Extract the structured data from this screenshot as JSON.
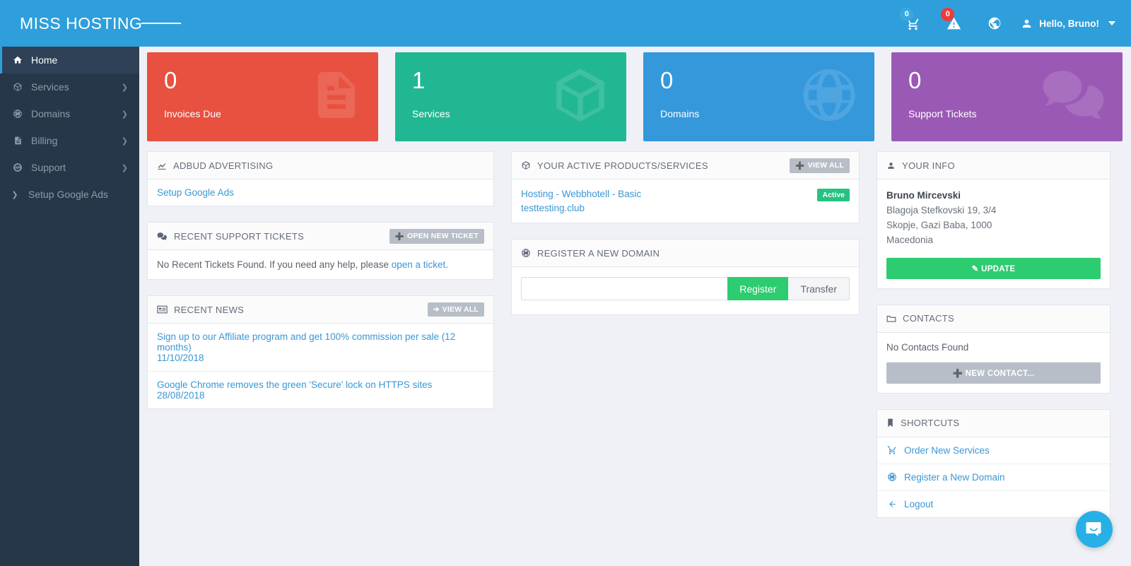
{
  "header": {
    "brand": "MISS HOSTING",
    "menu_toggle_icon": "hamburger-icon",
    "cart_badge": "0",
    "alert_badge": "0",
    "user_greeting": "Hello, Bruno!"
  },
  "sidebar": {
    "items": [
      {
        "label": "Home",
        "icon": "home-icon",
        "active": true,
        "chevron": false
      },
      {
        "label": "Services",
        "icon": "box-icon",
        "active": false,
        "chevron": true
      },
      {
        "label": "Domains",
        "icon": "globe-icon",
        "active": false,
        "chevron": true
      },
      {
        "label": "Billing",
        "icon": "file-icon",
        "active": false,
        "chevron": true
      },
      {
        "label": "Support",
        "icon": "lifering-icon",
        "active": false,
        "chevron": true
      },
      {
        "label": "Setup Google Ads",
        "icon": "chevron-right-icon",
        "active": false,
        "chevron": false
      }
    ]
  },
  "stats": [
    {
      "value": "0",
      "label": "Invoices Due",
      "color": "#e8503f",
      "icon": "invoice-icon"
    },
    {
      "value": "1",
      "label": "Services",
      "color": "#22b793",
      "icon": "box-icon"
    },
    {
      "value": "0",
      "label": "Domains",
      "color": "#3498db",
      "icon": "globe-icon"
    },
    {
      "value": "0",
      "label": "Support Tickets",
      "color": "#9b59b6",
      "icon": "comments-icon"
    }
  ],
  "adbud": {
    "title": "ADBUD ADVERTISING",
    "icon": "chart-line-icon",
    "link": "Setup Google Ads"
  },
  "tickets": {
    "title": "RECENT SUPPORT TICKETS",
    "icon": "comments-icon",
    "button": "OPEN NEW TICKET",
    "empty_prefix": "No Recent Tickets Found. If you need any help, please ",
    "empty_link": "open a ticket",
    "empty_suffix": "."
  },
  "news": {
    "title": "RECENT NEWS",
    "icon": "newspaper-icon",
    "button": "VIEW ALL",
    "items": [
      {
        "title": "Sign up to our Affiliate program and get 100% commission per sale (12 months)",
        "date": "11/10/2018"
      },
      {
        "title": "Google Chrome removes the green 'Secure' lock on HTTPS sites",
        "date": "28/08/2018"
      }
    ]
  },
  "services_panel": {
    "title": "YOUR ACTIVE PRODUCTS/SERVICES",
    "icon": "box-icon",
    "button": "VIEW ALL",
    "items": [
      {
        "name": "Hosting - Webbhotell - Basic",
        "domain": "testtesting.club",
        "status": "Active"
      }
    ]
  },
  "register_domain": {
    "title": "REGISTER A NEW DOMAIN",
    "icon": "globe-icon",
    "input_value": "",
    "input_placeholder": "",
    "register_button": "Register",
    "transfer_button": "Transfer"
  },
  "your_info": {
    "title": "YOUR INFO",
    "icon": "user-icon",
    "name": "Bruno Mircevski",
    "address1": "Blagoja Stefkovski 19, 3/4",
    "address2": "Skopje, Gazi Baba, 1000",
    "country": "Macedonia",
    "update_button": "UPDATE"
  },
  "contacts": {
    "title": "CONTACTS",
    "icon": "folder-icon",
    "empty": "No Contacts Found",
    "new_button": "NEW CONTACT..."
  },
  "shortcuts": {
    "title": "SHORTCUTS",
    "icon": "bookmark-icon",
    "items": [
      {
        "label": "Order New Services",
        "icon": "cart-icon"
      },
      {
        "label": "Register a New Domain",
        "icon": "globe-icon"
      },
      {
        "label": "Logout",
        "icon": "arrow-left-icon"
      }
    ]
  },
  "chat_widget": {
    "icon": "chat-smile-icon"
  }
}
